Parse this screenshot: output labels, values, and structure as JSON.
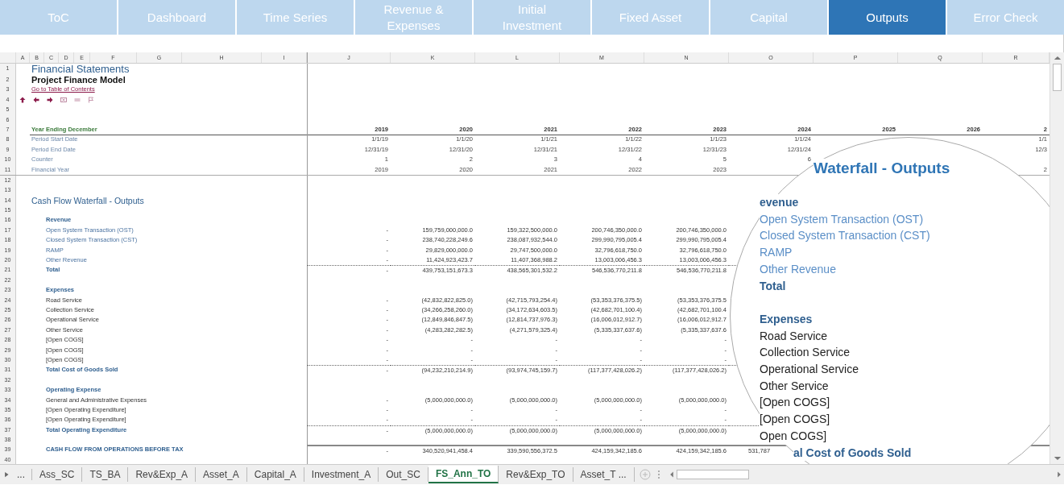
{
  "nav_tabs": [
    {
      "label": "ToC",
      "selected": false
    },
    {
      "label": "Dashboard",
      "selected": false
    },
    {
      "label": "Time Series",
      "selected": false
    },
    {
      "label": "Revenue & Expenses",
      "selected": false
    },
    {
      "label": "Initial Investment",
      "selected": false
    },
    {
      "label": "Fixed Asset",
      "selected": false
    },
    {
      "label": "Capital",
      "selected": false
    },
    {
      "label": "Outputs",
      "selected": true
    },
    {
      "label": "Error Check",
      "selected": false
    }
  ],
  "column_headers": [
    "A",
    "B",
    "C",
    "D",
    "E",
    "F",
    "G",
    "H",
    "I",
    "J",
    "K",
    "L",
    "M",
    "N",
    "O",
    "P",
    "Q",
    "R"
  ],
  "rows": [
    {
      "number": "1",
      "kind": "title",
      "label": "Financial Statements"
    },
    {
      "number": "2",
      "kind": "subtitle",
      "label": "Project Finance Model"
    },
    {
      "number": "3",
      "kind": "link",
      "label": "Go to Table of Contents"
    },
    {
      "number": "4",
      "kind": "icons"
    },
    {
      "number": "5",
      "kind": "blank"
    },
    {
      "number": "6",
      "kind": "blank"
    },
    {
      "number": "7",
      "kind": "year",
      "label": "Year Ending December",
      "values": {
        "J": "2019",
        "K": "2020",
        "L": "2021",
        "M": "2022",
        "N": "2023",
        "O": "2024",
        "P": "2025",
        "Q": "2026",
        "R": "2"
      }
    },
    {
      "number": "8",
      "kind": "timeline",
      "label": "Period Start Date",
      "values": {
        "J": "1/1/19",
        "K": "1/1/20",
        "L": "1/1/21",
        "M": "1/1/22",
        "N": "1/1/23",
        "O": "1/1/24",
        "R": "1/1"
      }
    },
    {
      "number": "9",
      "kind": "timeline",
      "label": "Period End Date",
      "values": {
        "J": "12/31/19",
        "K": "12/31/20",
        "L": "12/31/21",
        "M": "12/31/22",
        "N": "12/31/23",
        "O": "12/31/24",
        "R": "12/3"
      }
    },
    {
      "number": "10",
      "kind": "timeline",
      "label": "Counter",
      "values": {
        "J": "1",
        "K": "2",
        "L": "3",
        "M": "4",
        "N": "5",
        "O": "6"
      }
    },
    {
      "number": "11",
      "kind": "timeline_end",
      "label": "Financial Year",
      "values": {
        "J": "2019",
        "K": "2020",
        "L": "2021",
        "M": "2022",
        "N": "2023",
        "R": "2"
      }
    },
    {
      "number": "12",
      "kind": "blank"
    },
    {
      "number": "13",
      "kind": "blank"
    },
    {
      "number": "14",
      "kind": "section",
      "label": "Cash Flow Waterfall - Outputs"
    },
    {
      "number": "15",
      "kind": "blank"
    },
    {
      "number": "16",
      "kind": "group",
      "label": "Revenue"
    },
    {
      "number": "17",
      "kind": "item_blue",
      "label": "Open System Transaction (OST)",
      "values": {
        "J": "-",
        "K": "159,759,000,000.0",
        "L": "159,322,500,000.0",
        "M": "200,746,350,000.0",
        "N": "200,746,350,000.0"
      }
    },
    {
      "number": "18",
      "kind": "item_blue",
      "label": "Closed System Transaction (CST)",
      "values": {
        "J": "-",
        "K": "238,740,228,249.6",
        "L": "238,087,932,544.0",
        "M": "299,990,795,005.4",
        "N": "299,990,795,005.4"
      }
    },
    {
      "number": "19",
      "kind": "item_blue",
      "label": "RAMP",
      "values": {
        "J": "-",
        "K": "29,829,000,000.0",
        "L": "29,747,500,000.0",
        "M": "32,796,618,750.0",
        "N": "32,796,618,750.0"
      }
    },
    {
      "number": "20",
      "kind": "item_blue",
      "label": "Other Revenue",
      "values": {
        "J": "-",
        "K": "11,424,923,423.7",
        "L": "11,407,368,988.2",
        "M": "13,003,006,456.3",
        "N": "13,003,006,456.3"
      }
    },
    {
      "number": "21",
      "kind": "total",
      "label": "Total",
      "values": {
        "J": "-",
        "K": "439,753,151,673.3",
        "L": "438,565,301,532.2",
        "M": "546,536,770,211.8",
        "N": "546,536,770,211.8"
      }
    },
    {
      "number": "22",
      "kind": "blank"
    },
    {
      "number": "23",
      "kind": "group",
      "label": "Expenses"
    },
    {
      "number": "24",
      "kind": "item",
      "label": "Road Service",
      "values": {
        "J": "-",
        "K": "(42,832,822,825.0)",
        "L": "(42,715,793,254.4)",
        "M": "(53,353,376,375.5)",
        "N": "(53,353,376,375.5"
      }
    },
    {
      "number": "25",
      "kind": "item",
      "label": "Collection Service",
      "values": {
        "J": "-",
        "K": "(34,266,258,260.0)",
        "L": "(34,172,634,603.5)",
        "M": "(42,682,701,100.4)",
        "N": "(42,682,701,100.4"
      }
    },
    {
      "number": "26",
      "kind": "item",
      "label": "Operational Service",
      "values": {
        "J": "-",
        "K": "(12,849,846,847.5)",
        "L": "(12,814,737,976.3)",
        "M": "(16,006,012,912.7)",
        "N": "(16,006,012,912.7"
      }
    },
    {
      "number": "27",
      "kind": "item",
      "label": "Other Service",
      "values": {
        "J": "-",
        "K": "(4,283,282,282.5)",
        "L": "(4,271,579,325.4)",
        "M": "(5,335,337,637.6)",
        "N": "(5,335,337,637.6"
      }
    },
    {
      "number": "28",
      "kind": "item",
      "label": "[Open COGS]",
      "values": {
        "J": "-",
        "K": "-",
        "L": "-",
        "M": "-",
        "N": "-"
      }
    },
    {
      "number": "29",
      "kind": "item",
      "label": "[Open COGS]",
      "values": {
        "J": "-",
        "K": "-",
        "L": "-",
        "M": "-",
        "N": "-"
      }
    },
    {
      "number": "30",
      "kind": "item",
      "label": "[Open COGS]",
      "values": {
        "J": "-",
        "K": "-",
        "L": "-",
        "M": "-",
        "N": "-"
      }
    },
    {
      "number": "31",
      "kind": "total",
      "label": "Total Cost of Goods Sold",
      "values": {
        "J": "-",
        "K": "(94,232,210,214.9)",
        "L": "(93,974,745,159.7)",
        "M": "(117,377,428,026.2)",
        "N": "(117,377,428,026.2)"
      }
    },
    {
      "number": "32",
      "kind": "blank"
    },
    {
      "number": "33",
      "kind": "group",
      "label": "Operating Expense"
    },
    {
      "number": "34",
      "kind": "item",
      "label": "General and Administrative Expenses",
      "values": {
        "J": "-",
        "K": "(5,000,000,000.0)",
        "L": "(5,000,000,000.0)",
        "M": "(5,000,000,000.0)",
        "N": "(5,000,000,000.0)"
      }
    },
    {
      "number": "35",
      "kind": "item",
      "label": "[Open Operating Expenditure]",
      "values": {
        "J": "-",
        "K": "-",
        "L": "-",
        "M": "-",
        "N": "-"
      }
    },
    {
      "number": "36",
      "kind": "item",
      "label": "[Open Operating Expenditure]",
      "values": {
        "J": "-",
        "K": "-",
        "L": "-",
        "M": "-",
        "N": "-"
      }
    },
    {
      "number": "37",
      "kind": "total",
      "label": "Total Operating Expenditure",
      "values": {
        "J": "-",
        "K": "(5,000,000,000.0)",
        "L": "(5,000,000,000.0)",
        "M": "(5,000,000,000.0)",
        "N": "(5,000,000,000.0)"
      }
    },
    {
      "number": "38",
      "kind": "blank"
    },
    {
      "number": "39",
      "kind": "cashflow",
      "label": "CASH FLOW FROM OPERATIONS BEFORE TAX",
      "values": {
        "J": "-",
        "K": "340,520,941,458.4",
        "L": "339,590,556,372.5",
        "M": "424,159,342,185.6",
        "N": "424,159,342,185.6",
        "O": "531,787"
      }
    },
    {
      "number": "40",
      "kind": "blank"
    }
  ],
  "sheet_tabs": [
    {
      "label": "Ass_SC",
      "selected": false
    },
    {
      "label": "TS_BA",
      "selected": false
    },
    {
      "label": "Rev&Exp_A",
      "selected": false
    },
    {
      "label": "Asset_A",
      "selected": false
    },
    {
      "label": "Capital_A",
      "selected": false
    },
    {
      "label": "Investment_A",
      "selected": false
    },
    {
      "label": "Out_SC",
      "selected": false
    },
    {
      "label": "FS_Ann_TO",
      "selected": true
    },
    {
      "label": "Rev&Exp_TO",
      "selected": false
    },
    {
      "label": "Asset_T ...",
      "selected": false
    }
  ],
  "sheet_tabs_more": "...",
  "magnifier": [
    {
      "kind": "title",
      "text": "Waterfall - Outputs"
    },
    {
      "kind": "group",
      "text": "evenue"
    },
    {
      "kind": "item_blue",
      "text": "Open System Transaction (OST)"
    },
    {
      "kind": "item_blue",
      "text": "Closed System Transaction (CST)"
    },
    {
      "kind": "item_blue",
      "text": "RAMP"
    },
    {
      "kind": "item_blue",
      "text": "Other Revenue"
    },
    {
      "kind": "total",
      "text": "Total"
    },
    {
      "kind": "group",
      "text": "Expenses"
    },
    {
      "kind": "item",
      "text": "Road Service"
    },
    {
      "kind": "item",
      "text": "Collection Service"
    },
    {
      "kind": "item",
      "text": "Operational Service"
    },
    {
      "kind": "item",
      "text": "Other Service"
    },
    {
      "kind": "item",
      "text": "[Open COGS]"
    },
    {
      "kind": "item",
      "text": "[Open COGS]"
    },
    {
      "kind": "item",
      "text": "Open COGS]"
    },
    {
      "kind": "total",
      "text": "al Cost of Goods Sold"
    }
  ]
}
